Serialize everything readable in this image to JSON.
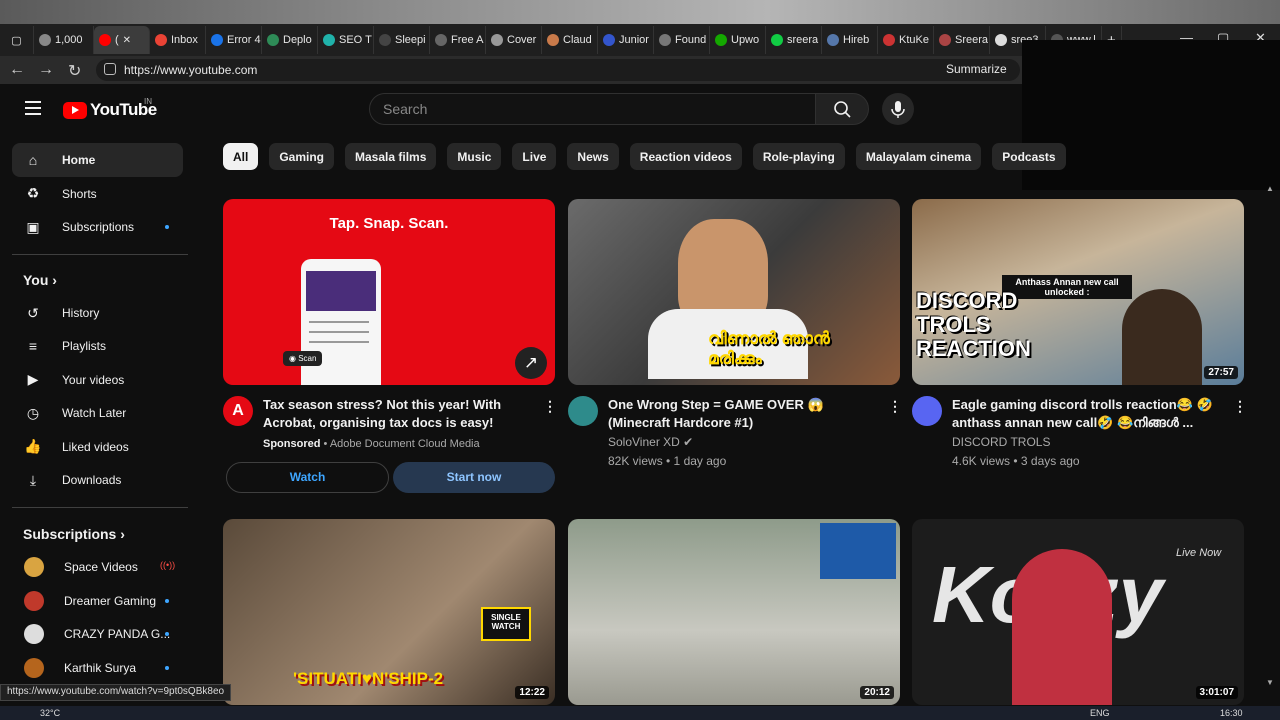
{
  "browser": {
    "tabs": [
      {
        "label": "1,000",
        "color": "#888888"
      },
      {
        "label": "(",
        "color": "#ff0000",
        "active": true
      },
      {
        "label": "Inbox",
        "color": "#ea4335"
      },
      {
        "label": "Error 4",
        "color": "#1a73e8"
      },
      {
        "label": "Deplo",
        "color": "#2e8b57"
      },
      {
        "label": "SEO T",
        "color": "#20b2aa"
      },
      {
        "label": "Sleepi",
        "color": "#444444"
      },
      {
        "label": "Free A",
        "color": "#666666"
      },
      {
        "label": "Cover",
        "color": "#999999"
      },
      {
        "label": "Claud",
        "color": "#c97a4a"
      },
      {
        "label": "Junior",
        "color": "#3355cc"
      },
      {
        "label": "Found",
        "color": "#777777"
      },
      {
        "label": "Upwo",
        "color": "#14a800"
      },
      {
        "label": "sreera",
        "color": "#11cc44"
      },
      {
        "label": "Hireb",
        "color": "#5577aa"
      },
      {
        "label": "KtuKe",
        "color": "#cc3333"
      },
      {
        "label": "Sreera",
        "color": "#aa4444"
      },
      {
        "label": "sree3",
        "color": "#dddddd"
      },
      {
        "label": "www.l",
        "color": "#555555"
      }
    ],
    "new_tab": "+",
    "url": "https://www.youtube.com",
    "summarize": "Summarize",
    "status_url": "https://www.youtube.com/watch?v=9pt0sQBk8eo"
  },
  "header": {
    "logo_text": "YouTube",
    "country": "IN",
    "search_placeholder": "Search"
  },
  "sidebar": {
    "main": [
      {
        "label": "Home",
        "icon": "home-icon",
        "glyph": "⌂",
        "active": true
      },
      {
        "label": "Shorts",
        "icon": "shorts-icon",
        "glyph": "♻"
      },
      {
        "label": "Subscriptions",
        "icon": "subscriptions-icon",
        "glyph": "▣",
        "dot": true
      }
    ],
    "you_heading": "You",
    "you_items": [
      {
        "label": "History",
        "icon": "history-icon",
        "glyph": "↺"
      },
      {
        "label": "Playlists",
        "icon": "playlists-icon",
        "glyph": "≡"
      },
      {
        "label": "Your videos",
        "icon": "your-videos-icon",
        "glyph": "▶"
      },
      {
        "label": "Watch Later",
        "icon": "watch-later-icon",
        "glyph": "◷"
      },
      {
        "label": "Liked videos",
        "icon": "liked-icon",
        "glyph": "👍"
      },
      {
        "label": "Downloads",
        "icon": "downloads-icon",
        "glyph": "⤓"
      }
    ],
    "subs_heading": "Subscriptions",
    "subscriptions": [
      {
        "label": "Space Videos",
        "color": "#d9a441",
        "live": true
      },
      {
        "label": "Dreamer Gaming",
        "color": "#c0392b",
        "dot": true
      },
      {
        "label": "CRAZY PANDA G...",
        "color": "#dddddd",
        "dot": true
      },
      {
        "label": "Karthik Surya",
        "color": "#b5651d",
        "dot": true
      }
    ]
  },
  "chips": [
    "All",
    "Gaming",
    "Masala films",
    "Music",
    "Live",
    "News",
    "Reaction videos",
    "Role-playing",
    "Malayalam cinema",
    "Podcasts"
  ],
  "ad": {
    "thumb_headline": "Tap. Snap. Scan.",
    "scan_label": "Scan",
    "title": "Tax season stress? Not this year! With Acrobat, organising tax docs is easy!",
    "sponsored": "Sponsored",
    "advertiser": "Adobe Document Cloud Media",
    "watch_label": "Watch",
    "start_label": "Start now"
  },
  "videos": [
    {
      "title": "One Wrong Step = GAME OVER 😱 (Minecraft Hardcore #1)",
      "channel": "SoloViner XD",
      "verified": true,
      "meta": "82K views • 1 day ago",
      "thumb_text": "വിണാൽ ഞാൻ മരിക്കും"
    },
    {
      "title": "Eagle gaming discord trolls reaction😂 🤣 anthass annan new call🤣 😂നിങ്ങൾ ...",
      "channel": "DISCORD TROLS",
      "meta": "4.6K views • 3 days ago",
      "duration": "27:57",
      "thumb_text": "DISCORD TROLS REACTION",
      "thumb_caption": "Anthass Annan new call unlocked :"
    },
    {
      "duration": "12:22",
      "thumb_text": "'SITUATI♥N'SHIP-2",
      "badge": "SINGLE WATCH"
    },
    {
      "duration": "20:12"
    },
    {
      "duration": "3:01:07",
      "thumb_text": "Kozzy",
      "live_now": "Live Now"
    }
  ],
  "taskbar": {
    "temp": "32°C",
    "lang": "ENG",
    "time": "16:30"
  }
}
